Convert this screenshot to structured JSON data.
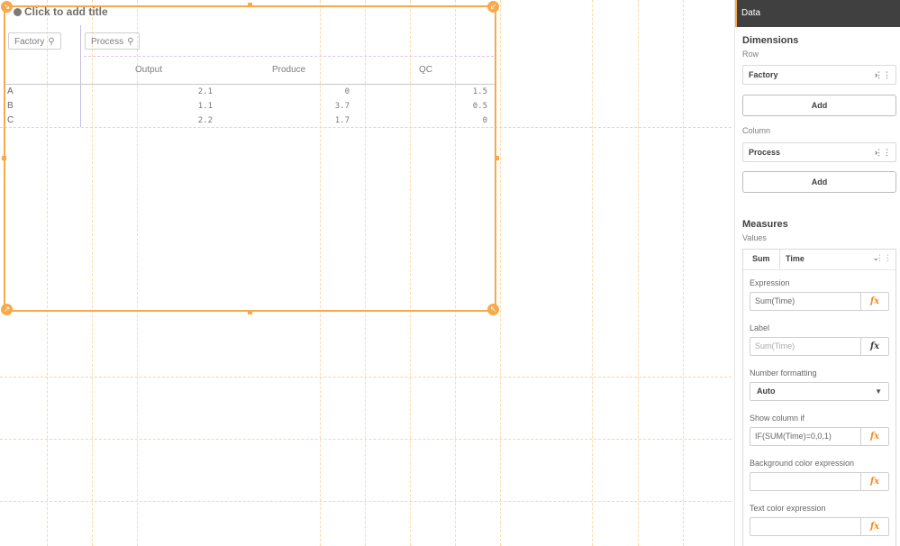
{
  "chart": {
    "title_placeholder": "Click to add title",
    "title_icon": "puzzle-icon",
    "row_dimension_chip": "Factory",
    "column_dimension_chip": "Process",
    "search_icon": "⌕",
    "columns": [
      "Output",
      "Produce",
      "QC"
    ],
    "rows": [
      {
        "label": "A",
        "values": [
          "2.1",
          "0",
          "1.5"
        ]
      },
      {
        "label": "B",
        "values": [
          "1.1",
          "3.7",
          "0.5"
        ]
      },
      {
        "label": "C",
        "values": [
          "2.2",
          "1.7",
          "0"
        ]
      }
    ]
  },
  "panel": {
    "header": "Data",
    "dimensions": {
      "title": "Dimensions",
      "row_label": "Row",
      "row_field": "Factory",
      "add_label": "Add",
      "column_label": "Column",
      "column_field": "Process",
      "add_label_2": "Add"
    },
    "measures": {
      "title": "Measures",
      "values_label": "Values",
      "aggregation": "Sum",
      "field": "Time",
      "expression_label": "Expression",
      "expression_value": "Sum(Time)",
      "label_label": "Label",
      "label_placeholder": "Sum(Time)",
      "number_formatting_label": "Number formatting",
      "number_formatting_value": "Auto",
      "show_column_if_label": "Show column if",
      "show_column_if_value": "IF(SUM(Time)=0,0,1)",
      "bg_color_label": "Background color expression",
      "bg_color_value": "",
      "text_color_label": "Text color expression",
      "text_color_value": "",
      "fx_label": "fx"
    },
    "colors": {
      "accent": "#f8a94a",
      "header_bg": "#404040",
      "fx_orange": "#f08a24"
    }
  }
}
